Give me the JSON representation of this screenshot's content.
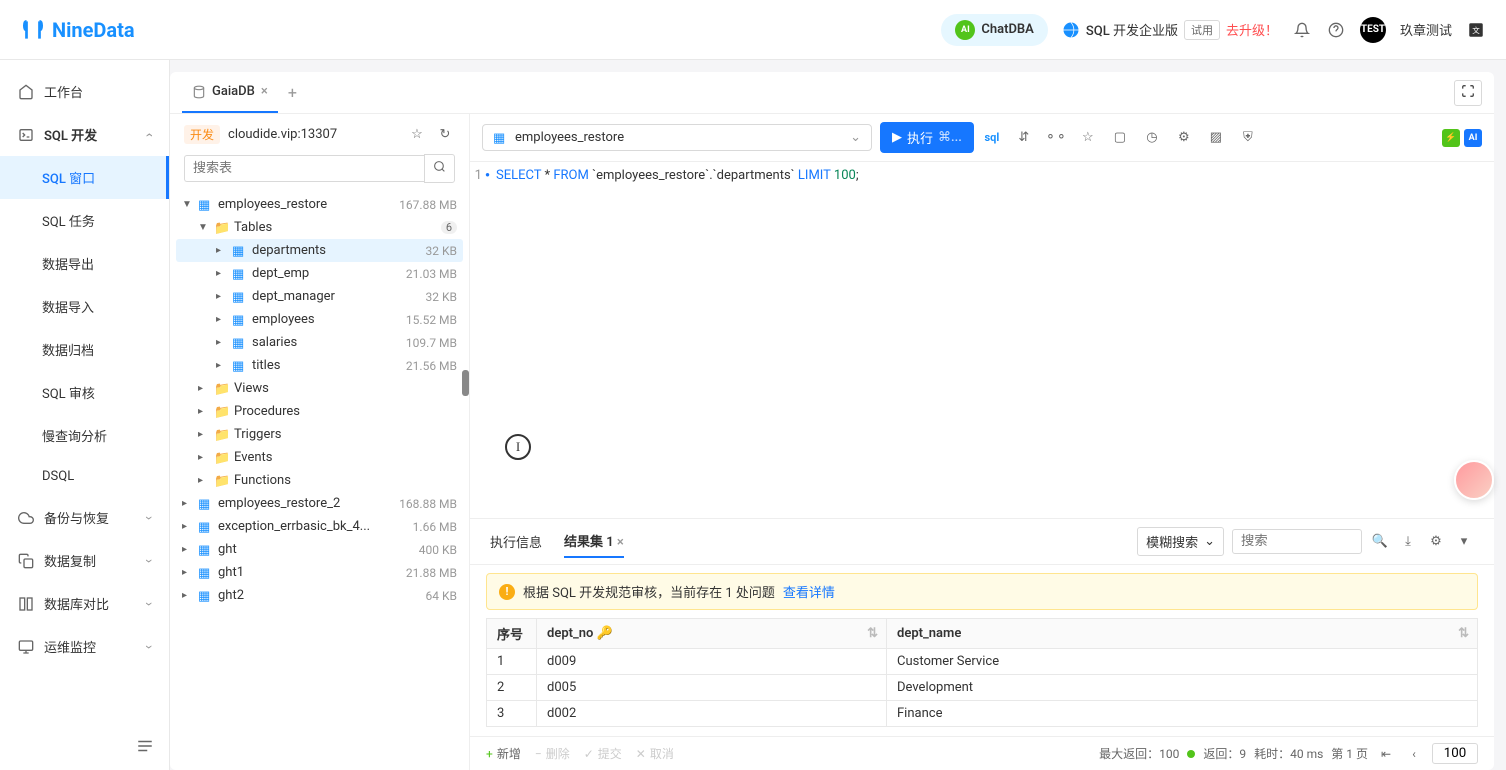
{
  "header": {
    "brand": "NineData",
    "chatdba": "ChatDBA",
    "sql_version": "SQL 开发企业版",
    "trial": "试用",
    "upgrade": "去升级！",
    "test_badge": "TEST",
    "username": "玖章测试"
  },
  "sidebar": {
    "workbench": "工作台",
    "sql_dev": "SQL 开发",
    "items": [
      "SQL 窗口",
      "SQL 任务",
      "数据导出",
      "数据导入",
      "数据归档",
      "SQL 审核",
      "慢查询分析",
      "DSQL"
    ],
    "backup": "备份与恢复",
    "replication": "数据复制",
    "compare": "数据库对比",
    "monitor": "运维监控"
  },
  "tab": {
    "name": "GaiaDB"
  },
  "conn": {
    "env": "开发",
    "host": "cloudide.vip:13307",
    "search_placeholder": "搜索表"
  },
  "tree": {
    "db_main": "employees_restore",
    "db_main_size": "167.88 MB",
    "tables_label": "Tables",
    "tables_count": "6",
    "tables": [
      {
        "name": "departments",
        "size": "32 KB"
      },
      {
        "name": "dept_emp",
        "size": "21.03 MB"
      },
      {
        "name": "dept_manager",
        "size": "32 KB"
      },
      {
        "name": "employees",
        "size": "15.52 MB"
      },
      {
        "name": "salaries",
        "size": "109.7 MB"
      },
      {
        "name": "titles",
        "size": "21.56 MB"
      }
    ],
    "folders": [
      "Views",
      "Procedures",
      "Triggers",
      "Events",
      "Functions"
    ],
    "other_dbs": [
      {
        "name": "employees_restore_2",
        "size": "168.88 MB"
      },
      {
        "name": "exception_errbasic_bk_4...",
        "size": "1.66 MB"
      },
      {
        "name": "ght",
        "size": "400 KB"
      },
      {
        "name": "ght1",
        "size": "21.88 MB"
      },
      {
        "name": "ght2",
        "size": "64 KB"
      }
    ]
  },
  "toolbar": {
    "db_selected": "employees_restore",
    "run": "执行",
    "run_shortcut": "⌘..."
  },
  "sql": {
    "line_no": "1",
    "text_select": "SELECT",
    "text_star": " * ",
    "text_from": "FROM",
    "text_tbl": " `employees_restore`.`departments` ",
    "text_limit": "LIMIT",
    "text_num": " 100",
    "text_semi": ";"
  },
  "results": {
    "tab_exec": "执行信息",
    "tab_result": "结果集 1",
    "fuzzy": "模糊搜索",
    "search_placeholder": "搜索",
    "warning": "根据 SQL 开发规范审核，当前存在 1 处问题",
    "warning_link": "查看详情",
    "col_seq": "序号",
    "col_dept_no": "dept_no",
    "col_dept_name": "dept_name",
    "rows": [
      {
        "seq": "1",
        "dept_no": "d009",
        "dept_name": "Customer Service"
      },
      {
        "seq": "2",
        "dept_no": "d005",
        "dept_name": "Development"
      },
      {
        "seq": "3",
        "dept_no": "d002",
        "dept_name": "Finance"
      }
    ],
    "footer": {
      "add": "新增",
      "delete": "删除",
      "submit": "提交",
      "cancel": "取消",
      "max_return": "最大返回：100",
      "returned": "返回：9",
      "elapsed": "耗时：40 ms",
      "page": "第 1 页",
      "page_size": "100"
    }
  }
}
